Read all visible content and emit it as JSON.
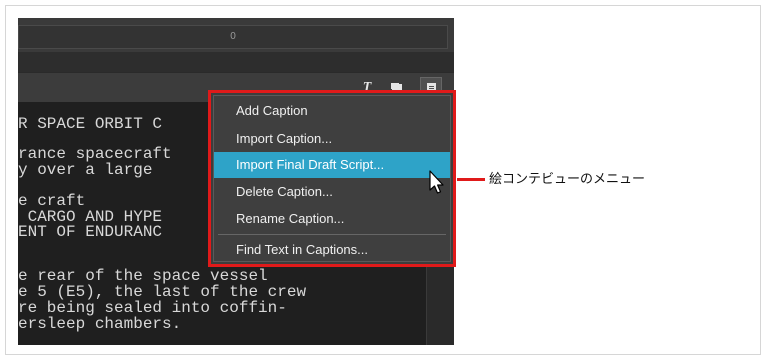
{
  "topbar": {
    "value": "0"
  },
  "toolbar": {
    "text_tool_label": "T"
  },
  "script": {
    "lines": [
      "R SPACE ORBIT C",
      "rance spacecraft",
      "y over a large",
      "e craft",
      " CARGO AND HYPE",
      "ENT OF ENDURANC",
      "e rear of the space vessel",
      "e 5 (E5), the last of the crew",
      "re being sealed into coffin-",
      "ersleep chambers."
    ]
  },
  "menu": {
    "items": [
      {
        "label": "Add Caption"
      },
      {
        "label": "Import Caption..."
      },
      {
        "label": "Import Final Draft Script..."
      },
      {
        "label": "Delete Caption..."
      },
      {
        "label": "Rename Caption..."
      },
      {
        "label": "Find Text in Captions..."
      }
    ],
    "selected_index": 2
  },
  "callout": {
    "text": "絵コンテビューのメニュー"
  },
  "colors": {
    "accent": "#2ea3c8",
    "highlight": "#e01a1a"
  }
}
